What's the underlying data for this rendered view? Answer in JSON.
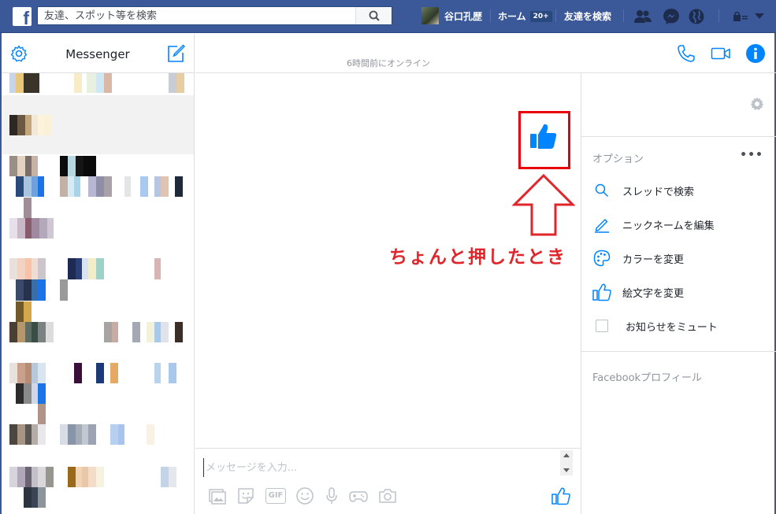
{
  "topbar": {
    "logo_letter": "f",
    "search_placeholder": "友達、スポット等を検索",
    "profile_name": "谷口孔歴",
    "home_label": "ホーム",
    "home_badge": "20+",
    "find_friends_label": "友達を検索"
  },
  "sidebar": {
    "title": "Messenger"
  },
  "conversation": {
    "active_status": "6時間前にオンライン",
    "composer_placeholder": "メッセージを入力...",
    "tools": [
      "photo-icon",
      "sticker-icon",
      "gif-icon",
      "emoji-icon",
      "mic-icon",
      "game-icon",
      "camera-icon"
    ],
    "gif_label": "GIF"
  },
  "annotation": {
    "text": "ちょんと押したとき",
    "color": "#e0262b"
  },
  "info_panel": {
    "options_label": "オプション",
    "more_label": "•••",
    "options": [
      {
        "label": "スレッドで検索",
        "icon": "search-icon"
      },
      {
        "label": "ニックネームを編集",
        "icon": "pencil-icon"
      },
      {
        "label": "カラーを変更",
        "icon": "palette-icon"
      },
      {
        "label": "絵文字を変更",
        "icon": "thumbs-up-icon"
      },
      {
        "label": "お知らせをミュート",
        "icon": "checkbox"
      }
    ],
    "profile_link": "Facebookプロフィール"
  },
  "colors": {
    "brand": "#3b5998",
    "messenger_blue": "#0084ff"
  }
}
